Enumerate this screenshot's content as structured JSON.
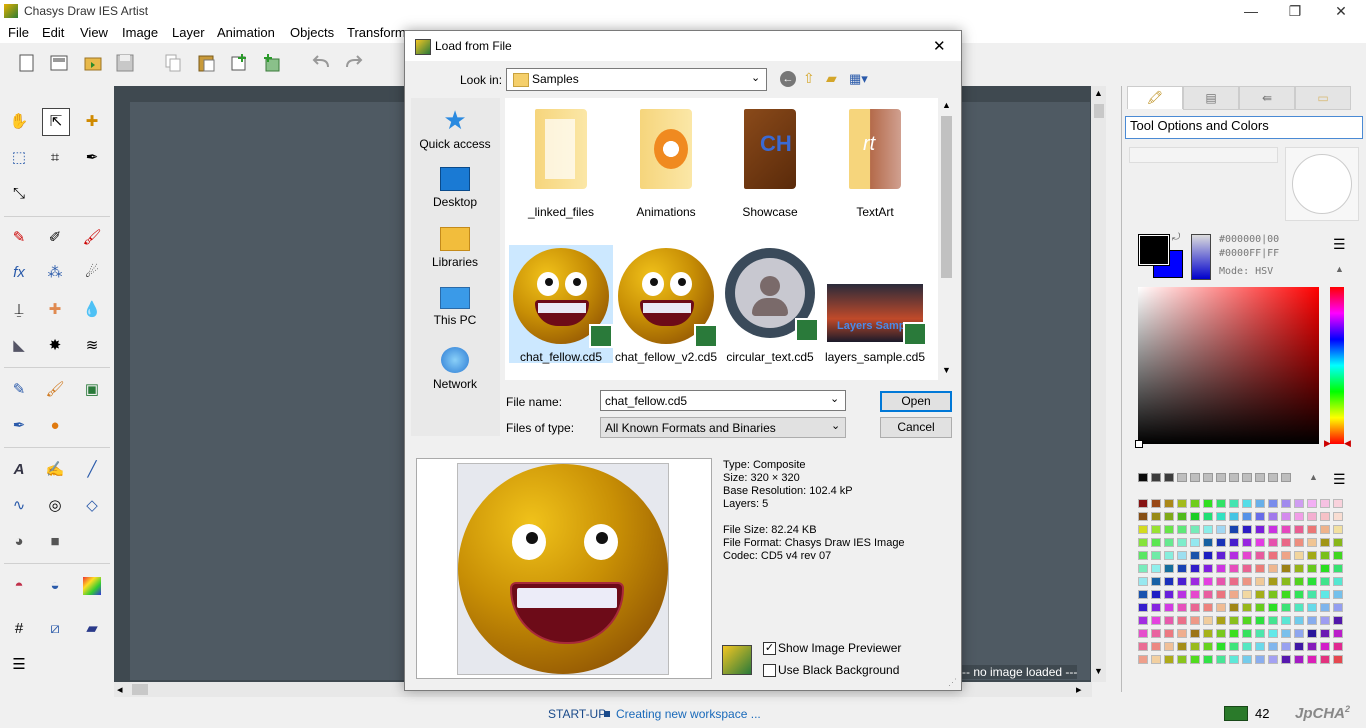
{
  "app": {
    "title": "Chasys Draw IES Artist",
    "minimize": "—",
    "restore": "❐",
    "close": "✕"
  },
  "menu": [
    "File",
    "Edit",
    "View",
    "Image",
    "Layer",
    "Animation",
    "Objects",
    "Transforms"
  ],
  "workspace": {
    "no_image": "--- no image loaded ---"
  },
  "status": {
    "phase": "START-UP",
    "message": "Creating new workspace ...",
    "count": "42",
    "brand": "JpCHA",
    "brand_sup": "2"
  },
  "right_panel": {
    "title": "Tool Options and Colors",
    "primary_color": "#000000",
    "secondary_color": "#0000FF",
    "hex_line1": "#000000|00",
    "hex_line2": "#0000FF|FF",
    "mode": "Mode: HSV"
  },
  "dialog": {
    "title": "Load from File",
    "close": "✕",
    "look_in_label": "Look in:",
    "look_in_value": "Samples",
    "nav": [
      {
        "label": "Quick access",
        "icon": "star-icon"
      },
      {
        "label": "Desktop",
        "icon": "desktop-icon"
      },
      {
        "label": "Libraries",
        "icon": "libraries-icon"
      },
      {
        "label": "This PC",
        "icon": "computer-icon"
      },
      {
        "label": "Network",
        "icon": "network-icon"
      }
    ],
    "folders": [
      "_linked_files",
      "Animations",
      "Showcase",
      "TextArt"
    ],
    "files": [
      "chat_fellow.cd5",
      "chat_fellow_v2.cd5",
      "circular_text.cd5",
      "layers_sample.cd5"
    ],
    "layers_thumb_text": "Layers Samp",
    "file_name_label": "File name:",
    "file_name_value": "chat_fellow.cd5",
    "files_of_type_label": "Files of type:",
    "files_of_type_value": "All Known Formats and Binaries",
    "open_button": "Open",
    "cancel_button": "Cancel",
    "info": [
      "Type: Composite",
      "Size: 320 × 320",
      "Base Resolution: 102.4 kP",
      "Layers: 5",
      "File Size: 82.24 KB",
      "File Format: Chasys Draw IES Image",
      "Codec: CD5 v4 rev 07"
    ],
    "show_previewer_label": "Show Image Previewer",
    "show_previewer_checked": true,
    "black_bg_label": "Use Black Background",
    "black_bg_checked": false
  }
}
